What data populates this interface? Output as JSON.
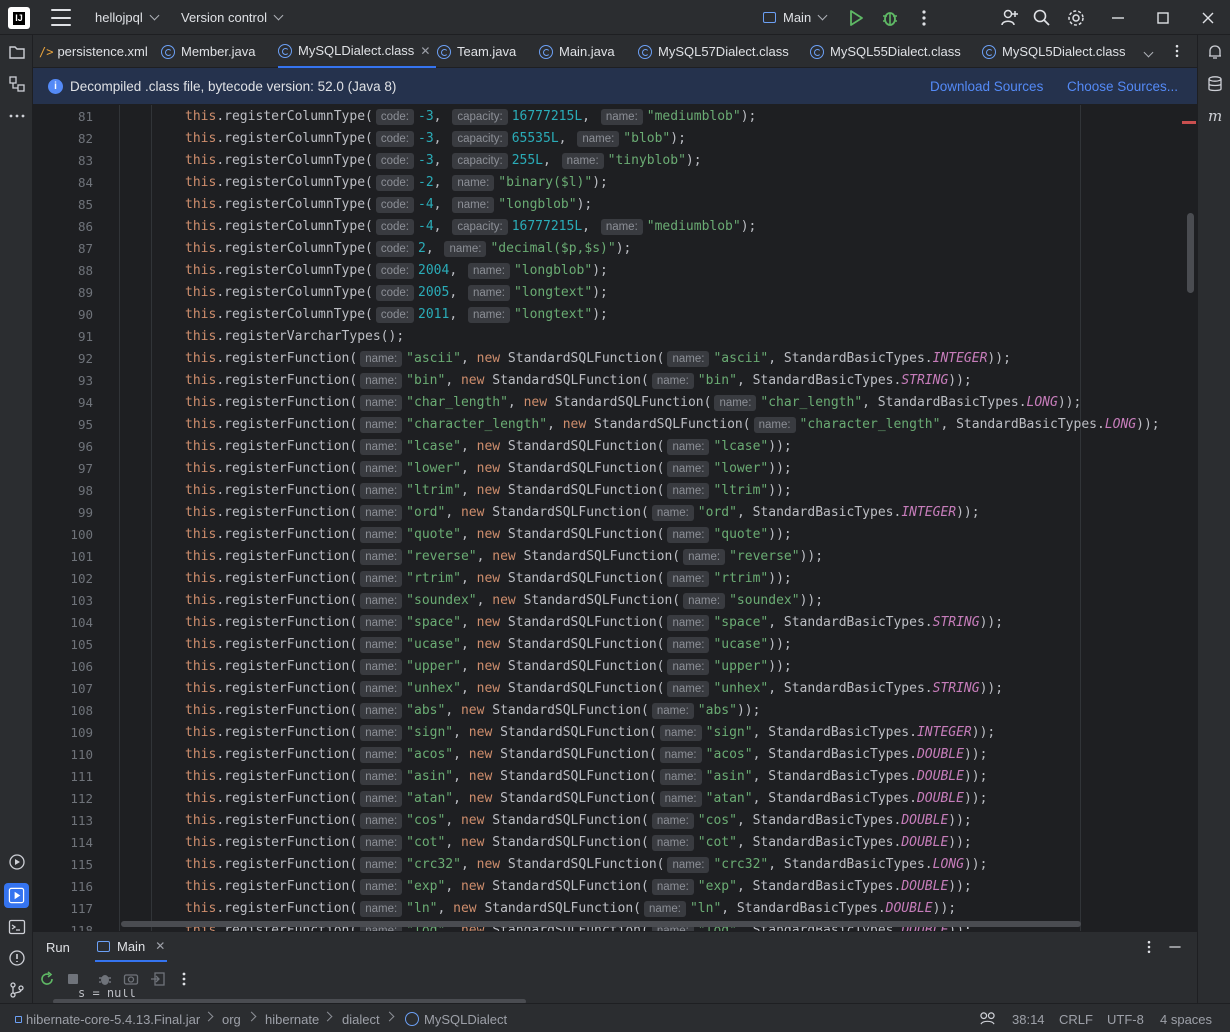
{
  "titlebar": {
    "project": "hellojpql",
    "vcs": "Version control",
    "run_config": "Main"
  },
  "tabs": [
    {
      "label": "persistence.xml",
      "type": "xml"
    },
    {
      "label": "Member.java",
      "type": "class"
    },
    {
      "label": "MySQLDialect.class",
      "type": "class",
      "active": true
    },
    {
      "label": "Team.java",
      "type": "class"
    },
    {
      "label": "Main.java",
      "type": "class"
    },
    {
      "label": "MySQL57Dialect.class",
      "type": "class"
    },
    {
      "label": "MySQL55Dialect.class",
      "type": "class"
    },
    {
      "label": "MySQL5Dialect.class",
      "type": "class"
    }
  ],
  "banner": {
    "text": "Decompiled .class file, bytecode version: 52.0 (Java 8)",
    "download": "Download Sources",
    "choose": "Choose Sources..."
  },
  "colors": {
    "keyword": "#cf8e6d",
    "string": "#6aab73",
    "number": "#2aacb8",
    "constant": "#c77dbb",
    "accent": "#3574f0"
  },
  "code_lines": [
    {
      "n": "81",
      "kind": "col",
      "hints": [
        [
          "code",
          "-3"
        ],
        [
          "capacity",
          "16777215L"
        ],
        [
          "name",
          "\"mediumblob\""
        ]
      ]
    },
    {
      "n": "82",
      "kind": "col",
      "hints": [
        [
          "code",
          "-3"
        ],
        [
          "capacity",
          "65535L"
        ],
        [
          "name",
          "\"blob\""
        ]
      ]
    },
    {
      "n": "83",
      "kind": "col",
      "hints": [
        [
          "code",
          "-3"
        ],
        [
          "capacity",
          "255L"
        ],
        [
          "name",
          "\"tinyblob\""
        ]
      ]
    },
    {
      "n": "84",
      "kind": "col",
      "hints": [
        [
          "code",
          "-2"
        ],
        [
          "name",
          "\"binary($l)\""
        ]
      ]
    },
    {
      "n": "85",
      "kind": "col",
      "hints": [
        [
          "code",
          "-4"
        ],
        [
          "name",
          "\"longblob\""
        ]
      ]
    },
    {
      "n": "86",
      "kind": "col",
      "hints": [
        [
          "code",
          "-4"
        ],
        [
          "capacity",
          "16777215L"
        ],
        [
          "name",
          "\"mediumblob\""
        ]
      ]
    },
    {
      "n": "87",
      "kind": "col",
      "hints": [
        [
          "code",
          "2"
        ],
        [
          "name",
          "\"decimal($p,$s)\""
        ]
      ]
    },
    {
      "n": "88",
      "kind": "col",
      "hints": [
        [
          "code",
          "2004"
        ],
        [
          "name",
          "\"longblob\""
        ]
      ]
    },
    {
      "n": "89",
      "kind": "col",
      "hints": [
        [
          "code",
          "2005"
        ],
        [
          "name",
          "\"longtext\""
        ]
      ]
    },
    {
      "n": "90",
      "kind": "col",
      "hints": [
        [
          "code",
          "2011"
        ],
        [
          "name",
          "\"longtext\""
        ]
      ]
    },
    {
      "n": "91",
      "kind": "plain",
      "text": "this.registerVarcharTypes();"
    },
    {
      "n": "92",
      "kind": "fn",
      "name": "ascii",
      "type": "INTEGER"
    },
    {
      "n": "93",
      "kind": "fn",
      "name": "bin",
      "type": "STRING"
    },
    {
      "n": "94",
      "kind": "fn",
      "name": "char_length",
      "type": "LONG"
    },
    {
      "n": "95",
      "kind": "fn",
      "name": "character_length",
      "type": "LONG"
    },
    {
      "n": "96",
      "kind": "fn",
      "name": "lcase"
    },
    {
      "n": "97",
      "kind": "fn",
      "name": "lower"
    },
    {
      "n": "98",
      "kind": "fn",
      "name": "ltrim"
    },
    {
      "n": "99",
      "kind": "fn",
      "name": "ord",
      "type": "INTEGER"
    },
    {
      "n": "100",
      "kind": "fn",
      "name": "quote"
    },
    {
      "n": "101",
      "kind": "fn",
      "name": "reverse"
    },
    {
      "n": "102",
      "kind": "fn",
      "name": "rtrim"
    },
    {
      "n": "103",
      "kind": "fn",
      "name": "soundex"
    },
    {
      "n": "104",
      "kind": "fn",
      "name": "space",
      "type": "STRING"
    },
    {
      "n": "105",
      "kind": "fn",
      "name": "ucase"
    },
    {
      "n": "106",
      "kind": "fn",
      "name": "upper"
    },
    {
      "n": "107",
      "kind": "fn",
      "name": "unhex",
      "type": "STRING"
    },
    {
      "n": "108",
      "kind": "fn",
      "name": "abs"
    },
    {
      "n": "109",
      "kind": "fn",
      "name": "sign",
      "type": "INTEGER"
    },
    {
      "n": "110",
      "kind": "fn",
      "name": "acos",
      "type": "DOUBLE"
    },
    {
      "n": "111",
      "kind": "fn",
      "name": "asin",
      "type": "DOUBLE"
    },
    {
      "n": "112",
      "kind": "fn",
      "name": "atan",
      "type": "DOUBLE"
    },
    {
      "n": "113",
      "kind": "fn",
      "name": "cos",
      "type": "DOUBLE"
    },
    {
      "n": "114",
      "kind": "fn",
      "name": "cot",
      "type": "DOUBLE"
    },
    {
      "n": "115",
      "kind": "fn",
      "name": "crc32",
      "type": "LONG"
    },
    {
      "n": "116",
      "kind": "fn",
      "name": "exp",
      "type": "DOUBLE"
    },
    {
      "n": "117",
      "kind": "fn",
      "name": "ln",
      "type": "DOUBLE"
    },
    {
      "n": "118",
      "kind": "fn",
      "name": "log",
      "type": "DOUBLE"
    }
  ],
  "run": {
    "title": "Run",
    "tab": "Main",
    "console": "s = null"
  },
  "status": {
    "breadcrumb": [
      "hibernate-core-5.4.13.Final.jar",
      "org",
      "hibernate",
      "dialect",
      "MySQLDialect"
    ],
    "position": "38:14",
    "line_sep": "CRLF",
    "encoding": "UTF-8",
    "indent": "4 spaces"
  }
}
